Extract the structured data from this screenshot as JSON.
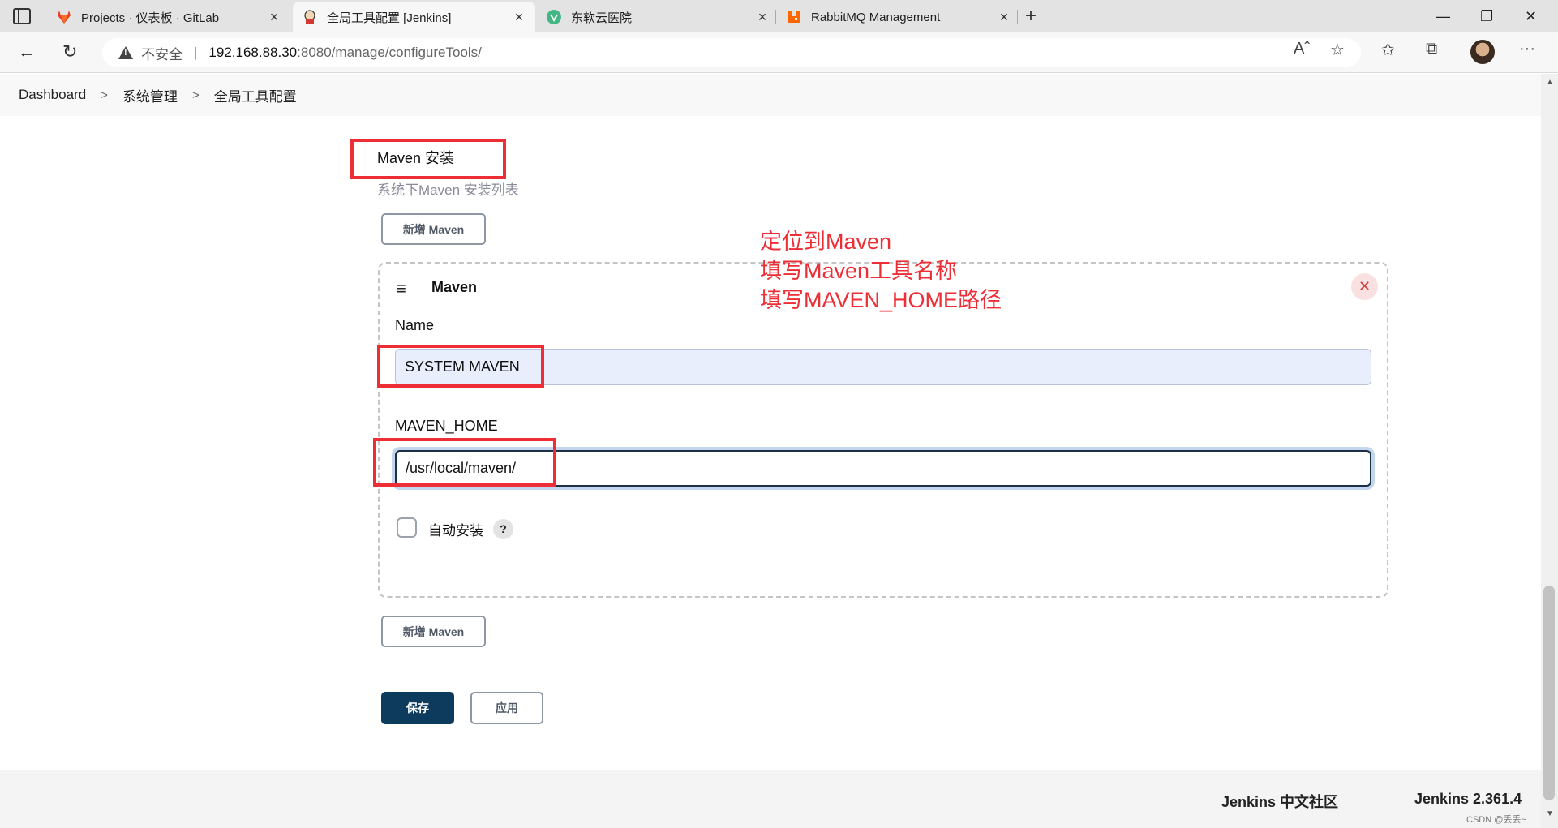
{
  "browser": {
    "tabs": [
      {
        "label": "Projects · 仪表板 · GitLab",
        "active": false
      },
      {
        "label": "全局工具配置 [Jenkins]",
        "active": true
      },
      {
        "label": "东软云医院",
        "active": false
      },
      {
        "label": "RabbitMQ Management",
        "active": false
      }
    ],
    "address": {
      "insecure_label": "不安全",
      "separator": "|",
      "host": "192.168.88.30",
      "path": ":8080/manage/configureTools/"
    },
    "colors": {
      "gitlab": "#e24329",
      "rabbitmq": "#ff6600",
      "vue": "#41b883"
    }
  },
  "breadcrumb": {
    "items": [
      "Dashboard",
      "系统管理",
      "全局工具配置"
    ],
    "separator": ">"
  },
  "maven_section": {
    "title": "Maven 安装",
    "description": "系统下Maven 安装列表",
    "add_button_label": "新增 Maven",
    "card": {
      "title": "Maven",
      "name_label": "Name",
      "name_value": "SYSTEM MAVEN",
      "home_label": "MAVEN_HOME",
      "home_value": "/usr/local/maven/",
      "auto_install_label": "自动安装",
      "auto_install_checked": false,
      "help_symbol": "?"
    }
  },
  "actions": {
    "save_label": "保存",
    "apply_label": "应用"
  },
  "annotation": {
    "lines": [
      "定位到Maven",
      "填写Maven工具名称",
      "填写MAVEN_HOME路径"
    ],
    "color": "#ee2e36"
  },
  "footer": {
    "community_label": "Jenkins 中文社区",
    "version_label": "Jenkins 2.361.4",
    "watermark": "CSDN @丢丢~"
  }
}
